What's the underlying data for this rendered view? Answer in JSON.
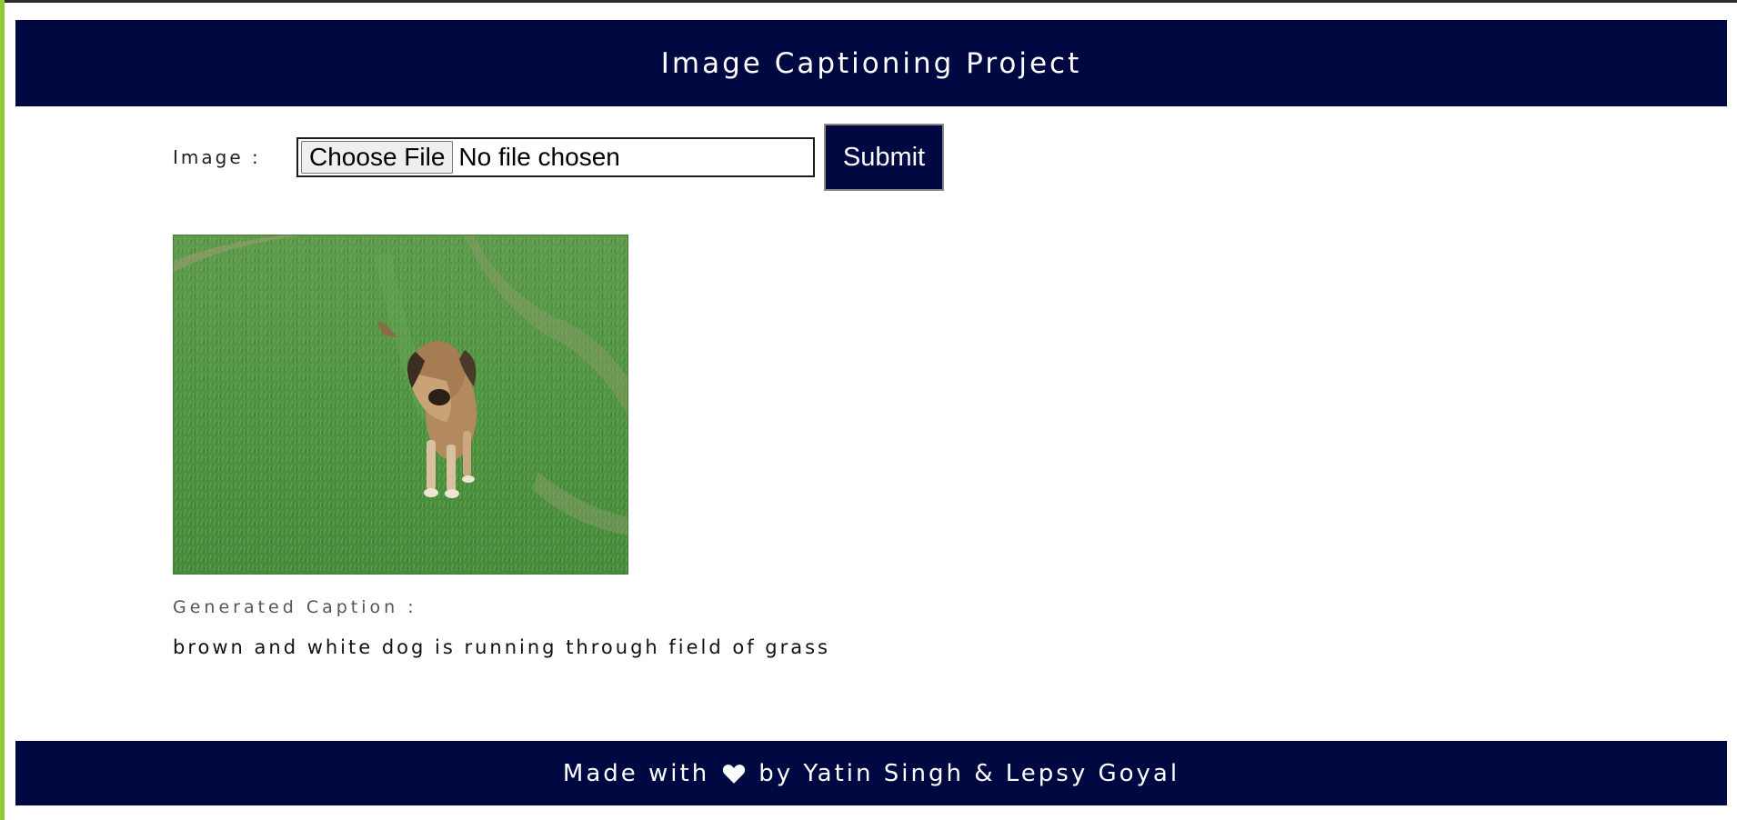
{
  "header": {
    "title": "Image Captioning Project"
  },
  "upload": {
    "label": "Image :",
    "choose_file_label": "Choose File",
    "file_status": "No file chosen",
    "submit_label": "Submit"
  },
  "result": {
    "caption_label": "Generated Caption :",
    "caption_text": "brown and white dog is running through field of grass"
  },
  "footer": {
    "prefix": "Made with",
    "heart_icon": "heart-icon",
    "suffix": "by Yatin Singh & Lepsy Goyal"
  },
  "colors": {
    "navy": "#000842",
    "accent_green": "#8fc93a"
  }
}
